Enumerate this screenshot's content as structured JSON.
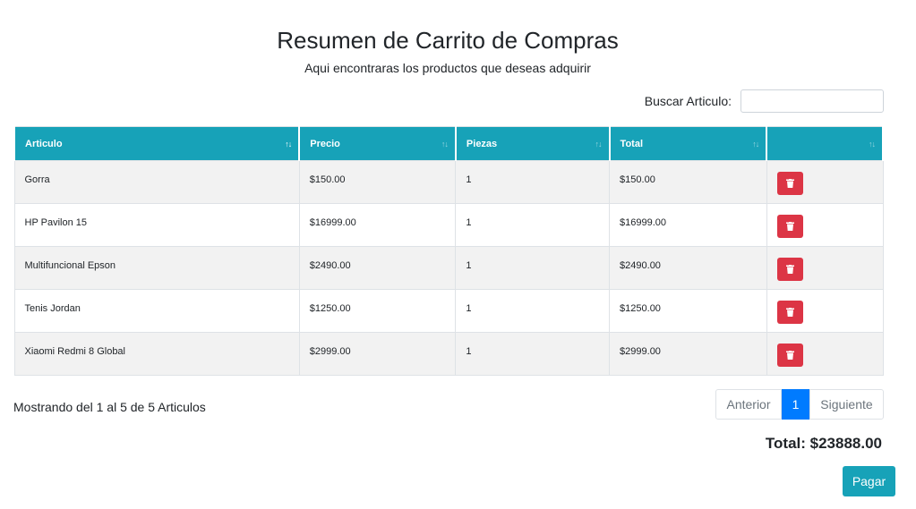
{
  "header": {
    "title": "Resumen de Carrito de Compras",
    "subtitle": "Aqui encontraras los productos que deseas adquirir"
  },
  "search": {
    "label": "Buscar Articulo:",
    "value": "",
    "placeholder": ""
  },
  "table": {
    "columns": [
      {
        "label": "Articulo",
        "sort_icon": "sort-icon"
      },
      {
        "label": "Precio",
        "sort_icon": "sort-icon"
      },
      {
        "label": "Piezas",
        "sort_icon": "sort-icon"
      },
      {
        "label": "Total",
        "sort_icon": "sort-icon"
      },
      {
        "label": "",
        "sort_icon": "sort-icon"
      }
    ],
    "rows": [
      {
        "articulo": "Gorra",
        "precio": "$150.00",
        "piezas": "1",
        "total": "$150.00",
        "action_icon": "trash-icon"
      },
      {
        "articulo": "HP Pavilon 15",
        "precio": "$16999.00",
        "piezas": "1",
        "total": "$16999.00",
        "action_icon": "trash-icon"
      },
      {
        "articulo": "Multifuncional Epson",
        "precio": "$2490.00",
        "piezas": "1",
        "total": "$2490.00",
        "action_icon": "trash-icon"
      },
      {
        "articulo": "Tenis Jordan",
        "precio": "$1250.00",
        "piezas": "1",
        "total": "$1250.00",
        "action_icon": "trash-icon"
      },
      {
        "articulo": "Xiaomi Redmi 8 Global",
        "precio": "$2999.00",
        "piezas": "1",
        "total": "$2999.00",
        "action_icon": "trash-icon"
      }
    ]
  },
  "info": "Mostrando del 1 al 5 de 5 Articulos",
  "pagination": {
    "prev": "Anterior",
    "current": "1",
    "next": "Siguiente"
  },
  "total": "Total: $23888.00",
  "pay_label": "Pagar",
  "colors": {
    "header_accent": "#17a2b8",
    "delete": "#dc3545",
    "active_page": "#007bff",
    "row_stripe": "#f2f2f2"
  }
}
